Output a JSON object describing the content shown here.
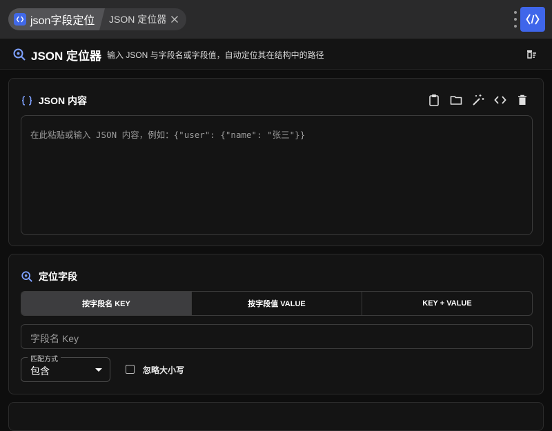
{
  "tabs": {
    "active_label": "json字段定位",
    "inactive_label": "JSON 定位器"
  },
  "header": {
    "title": "JSON 定位器",
    "subtitle": "输入 JSON 与字段名或字段值，自动定位其在结构中的路径"
  },
  "json_card": {
    "title": "JSON 内容",
    "placeholder": "在此粘贴或输入 JSON 内容，例如：{\"user\": {\"name\": \"张三\"}}",
    "tools": [
      "clipboard-icon",
      "folder-icon",
      "magic-wand-icon",
      "code-icon",
      "trash-icon"
    ]
  },
  "locate_card": {
    "title": "定位字段",
    "modes": [
      {
        "label": "按字段名 KEY",
        "selected": true
      },
      {
        "label": "按字段值 VALUE",
        "selected": false
      },
      {
        "label": "KEY + VALUE",
        "selected": false
      }
    ],
    "key_placeholder": "字段名 Key",
    "match": {
      "legend": "匹配方式",
      "value": "包含"
    },
    "ignore_case": {
      "label": "忽略大小写",
      "checked": false
    }
  },
  "colors": {
    "accent": "#3f66ea",
    "background": "#0e0e0e",
    "card": "#141414"
  }
}
